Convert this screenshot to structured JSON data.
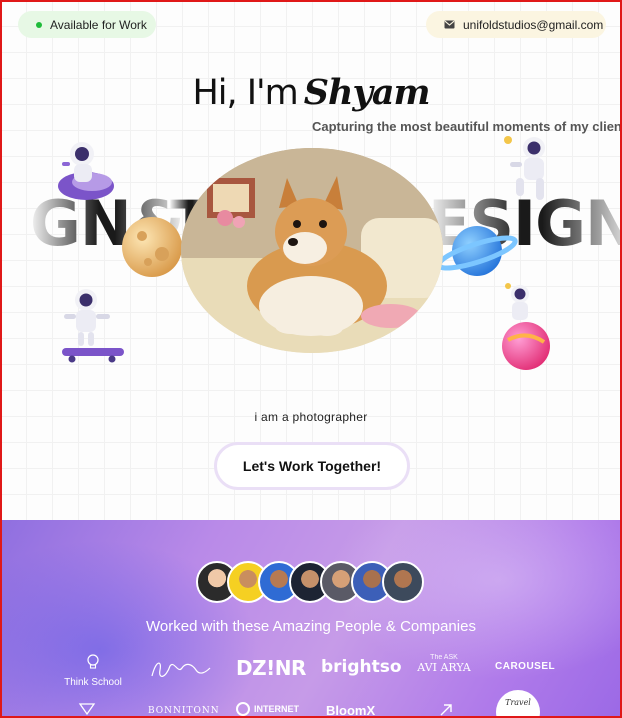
{
  "header": {
    "availability": "Available for Work",
    "email": "unifoldstudios@gmail.com",
    "status_color": "#1fbb3a"
  },
  "hero": {
    "greeting": "Hi, I'm",
    "name": "Shyam",
    "tagline": "Capturing the most beautiful moments of my clients",
    "marquee_left": "GN&",
    "marquee_mid": "T",
    "marquee_right": "ESIGN",
    "subtitle": "i am a photographer",
    "cta_label": "Let's Work Together!"
  },
  "clients": {
    "title": "Worked with these Amazing People & Companies",
    "logos": {
      "think_school": "Think School",
      "dzinr": "DZ!NR",
      "brightso": "brightso",
      "ask_avi_arya_small": "The ASK",
      "ask_avi_arya": "AVI ARYA",
      "carousel": "CAROUSEL",
      "bonnitonn": "BONNITONN",
      "internet": "INTERNET",
      "bloomx": "BloomX",
      "travel": "Travel"
    }
  },
  "icons": [
    "status-dot-icon",
    "mail-icon"
  ],
  "colors": {
    "accent_band": "#b98ae8",
    "cta_border": "#eadff6"
  }
}
